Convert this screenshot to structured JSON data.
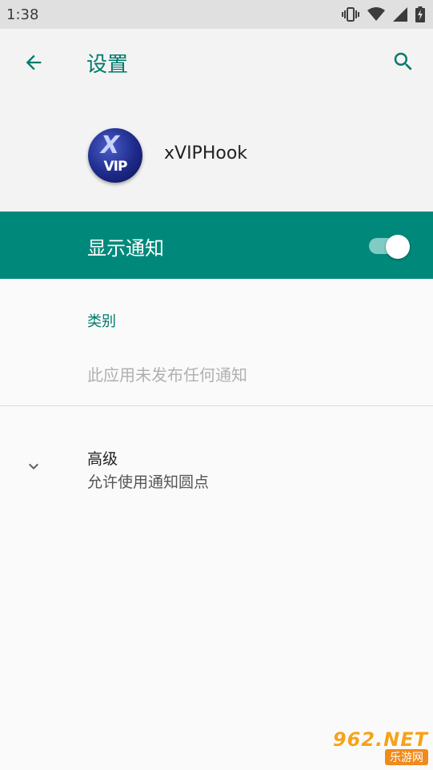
{
  "status_bar": {
    "time": "1:38",
    "icons": [
      "vibrate-icon",
      "wifi-icon",
      "signal-icon",
      "battery-charging-icon"
    ]
  },
  "app_bar": {
    "title": "设置",
    "back_icon": "arrow-back-icon",
    "search_icon": "search-icon",
    "accent_color": "#00796b"
  },
  "app_header": {
    "app_name": "xVIPHook",
    "logo_text": "VIP",
    "logo_mark": "X"
  },
  "notifications": {
    "label": "显示通知",
    "enabled": true,
    "row_color": "#00897b"
  },
  "category": {
    "heading": "类别",
    "empty_text": "此应用未发布任何通知"
  },
  "advanced": {
    "title": "高级",
    "summary": "允许使用通知圆点",
    "icon": "chevron-down-icon"
  },
  "watermark": {
    "main": "962.NET",
    "sub": "乐游网"
  }
}
